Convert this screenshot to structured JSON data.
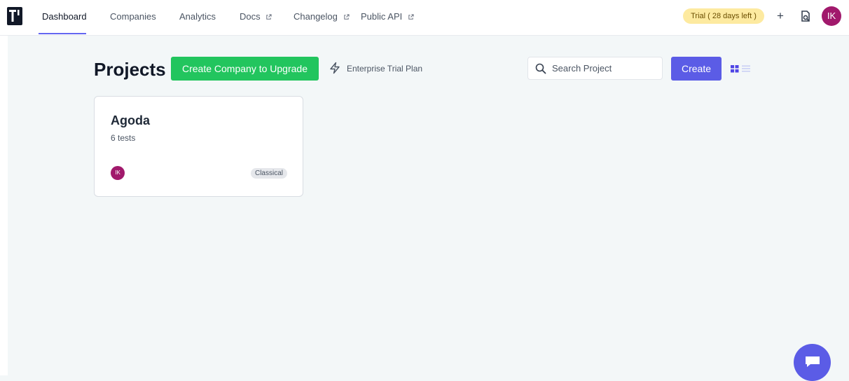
{
  "nav": {
    "items": [
      {
        "label": "Dashboard",
        "external": false,
        "active": true
      },
      {
        "label": "Companies",
        "external": false,
        "active": false
      },
      {
        "label": "Analytics",
        "external": false,
        "active": false
      },
      {
        "label": "Docs",
        "external": true,
        "active": false
      },
      {
        "label": "Changelog",
        "external": true,
        "active": false
      },
      {
        "label": "Public API",
        "external": true,
        "active": false
      }
    ],
    "trial_badge": "Trial ( 28 days left )",
    "plus_label": "+",
    "avatar_initials": "IK"
  },
  "header": {
    "title": "Projects",
    "upgrade_button": "Create Company to Upgrade",
    "plan_label": "Enterprise Trial Plan",
    "search_placeholder": "Search Project",
    "create_button": "Create"
  },
  "projects": [
    {
      "name": "Agoda",
      "count": "6 tests",
      "owner_initials": "IK",
      "type": "Classical"
    }
  ],
  "colors": {
    "accent": "#5b5ce6",
    "success": "#22c55e",
    "trial": "#fdeaa0",
    "avatar": "#a1196c",
    "background": "#f3f7f8"
  },
  "icons": {
    "logo": "testomat-logo",
    "external": "external-link-icon",
    "plan": "lightning-bolt-icon",
    "search": "search-icon",
    "grid": "grid-view-icon",
    "list": "list-view-icon",
    "chat": "chat-bubble-icon"
  }
}
